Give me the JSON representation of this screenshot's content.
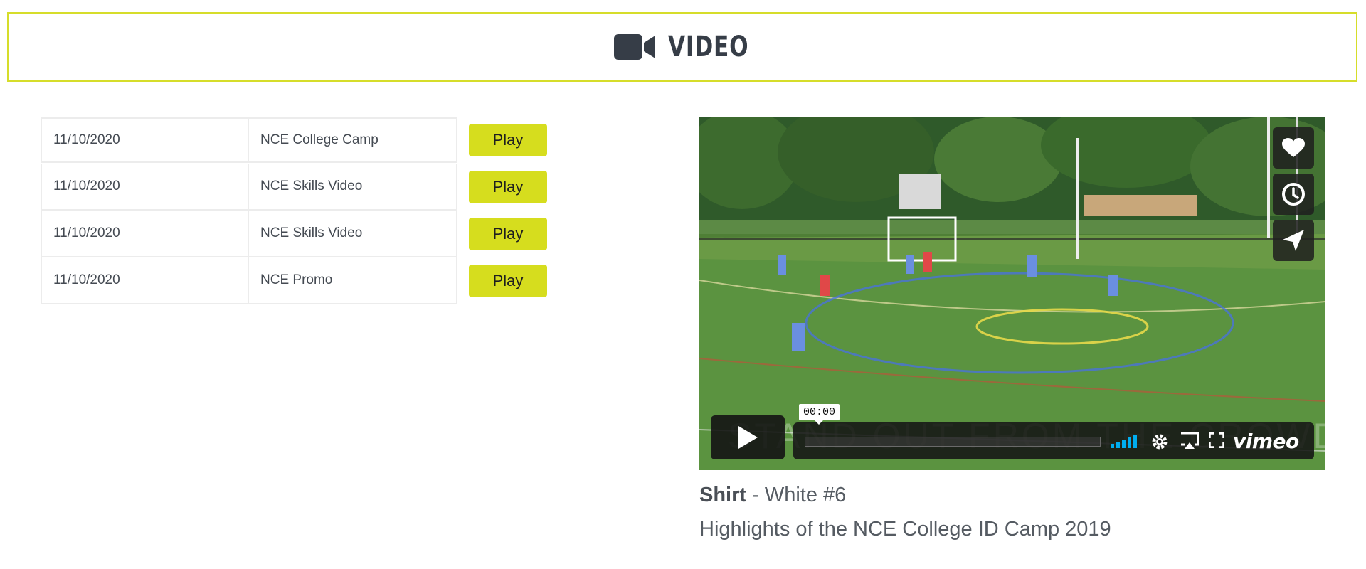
{
  "header": {
    "title": "VIDEO",
    "icon": "video-camera-icon",
    "border_color": "#d6dd2a"
  },
  "videos": [
    {
      "date": "11/10/2020",
      "title": "NCE College Camp",
      "action": "Play"
    },
    {
      "date": "11/10/2020",
      "title": "NCE Skills Video",
      "action": "Play"
    },
    {
      "date": "11/10/2020",
      "title": "NCE Skills Video",
      "action": "Play"
    },
    {
      "date": "11/10/2020",
      "title": "NCE Promo",
      "action": "Play"
    }
  ],
  "player": {
    "overlay_text": "STAND OUT FROM THE CROWD",
    "timecode": "00:00",
    "brand": "vimeo",
    "side_buttons": [
      "heart-icon",
      "clock-icon",
      "send-icon"
    ],
    "accent_color": "#00adef"
  },
  "caption": {
    "label": "Shirt",
    "value": " - White #6"
  },
  "description": "Highlights of the NCE College ID Camp 2019",
  "colors": {
    "play_button": "#d6dd1e",
    "text": "#444a52"
  }
}
